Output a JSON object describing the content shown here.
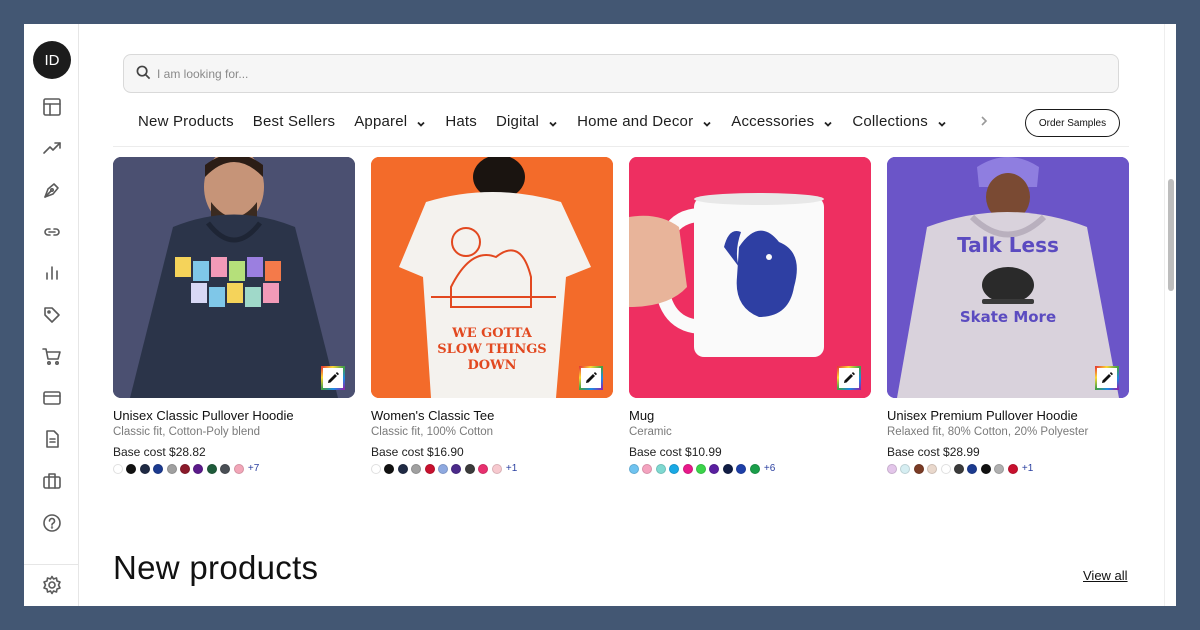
{
  "user": {
    "initials": "ID"
  },
  "sidebar": {
    "icons": [
      "layout-icon",
      "trending-icon",
      "pen-tool-icon",
      "link-icon",
      "bar-chart-icon",
      "tag-icon",
      "cart-icon",
      "credit-card-icon",
      "document-icon",
      "briefcase-icon",
      "help-icon",
      "settings-icon"
    ]
  },
  "search": {
    "placeholder": "I am looking for..."
  },
  "nav": {
    "items": [
      {
        "label": "New Products",
        "dropdown": false
      },
      {
        "label": "Best Sellers",
        "dropdown": false
      },
      {
        "label": "Apparel",
        "dropdown": true
      },
      {
        "label": "Hats",
        "dropdown": false
      },
      {
        "label": "Digital",
        "dropdown": true
      },
      {
        "label": "Home and Decor",
        "dropdown": true
      },
      {
        "label": "Accessories",
        "dropdown": true
      },
      {
        "label": "Collections",
        "dropdown": true
      }
    ],
    "order_samples": "Order Samples"
  },
  "products": [
    {
      "title": "Unisex Classic Pullover Hoodie",
      "subtitle": "Classic fit, Cotton-Poly blend",
      "cost": "Base cost $28.82",
      "background": "#4b5071",
      "colors": [
        "#ffffff",
        "#111111",
        "#1f2a44",
        "#1b3a8f",
        "#a0a0a0",
        "#8b1a2b",
        "#5b1a8a",
        "#1e5b3a",
        "#4a4f55",
        "#f2a6b8"
      ],
      "more": "+7"
    },
    {
      "title": "Women's Classic Tee",
      "subtitle": "Classic fit, 100% Cotton",
      "cost": "Base cost $16.90",
      "background": "#f36b2a",
      "colors": [
        "#ffffff",
        "#111111",
        "#1f2a44",
        "#a0a0a0",
        "#c8102e",
        "#8ea9e0",
        "#4b2a8a",
        "#3b3b3b",
        "#e8306f",
        "#f7c9cf"
      ],
      "more": "+1"
    },
    {
      "title": "Mug",
      "subtitle": "Ceramic",
      "cost": "Base cost $10.99",
      "background": "#ee2f61",
      "colors": [
        "#6fc3f0",
        "#f4a3bf",
        "#7fd9d1",
        "#19a9e5",
        "#e8198a",
        "#3bd44a",
        "#5a1fa0",
        "#111d44",
        "#1d3fa8",
        "#1a9e4a"
      ],
      "more": "+6"
    },
    {
      "title": "Unisex Premium Pullover Hoodie",
      "subtitle": "Relaxed fit, 80% Cotton, 20% Polyester",
      "cost": "Base cost $28.99",
      "background": "#6b55c8",
      "colors": [
        "#e3c6ea",
        "#d6eef2",
        "#7a3b25",
        "#e9d8cc",
        "#ffffff",
        "#3b3b3b",
        "#1b3a8f",
        "#111111",
        "#b0b0b0",
        "#c8102e"
      ],
      "more": "+1"
    }
  ],
  "section": {
    "title": "New products",
    "view_all": "View all"
  }
}
